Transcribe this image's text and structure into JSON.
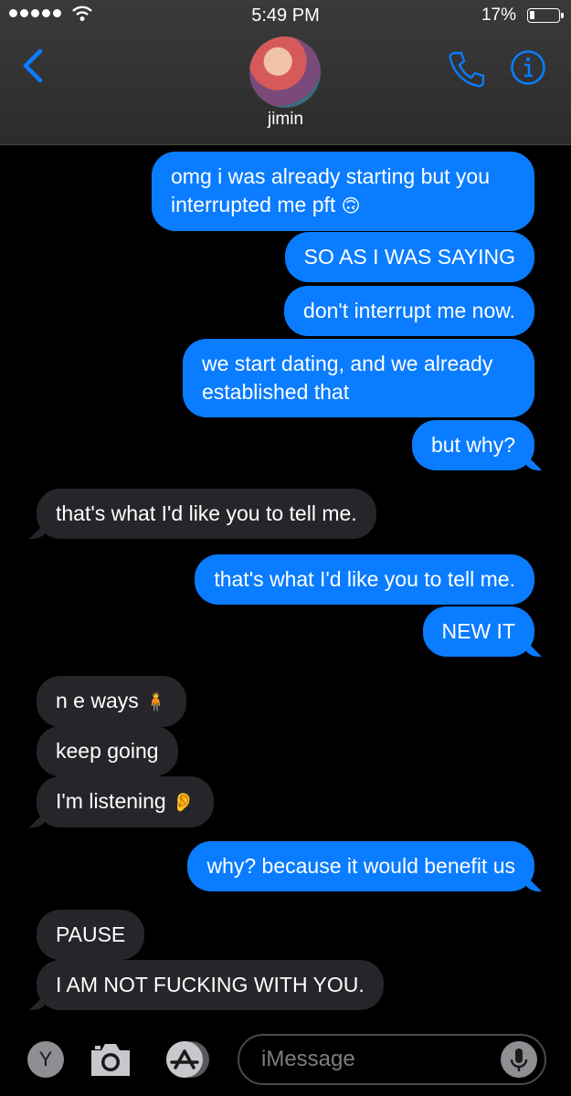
{
  "status": {
    "time": "5:49 PM",
    "battery_pct": "17%",
    "battery_level": 0.17
  },
  "header": {
    "contact_name": "jimin"
  },
  "messages": [
    {
      "dir": "sent",
      "text": "omg i was already starting but you\ninterrupted me pft",
      "emoji": "🙃"
    },
    {
      "dir": "sent",
      "text": "SO AS I WAS SAYING"
    },
    {
      "dir": "sent",
      "text": "don't interrupt me now."
    },
    {
      "dir": "sent",
      "text": "we start dating, and we already\nestablished that"
    },
    {
      "dir": "sent",
      "text": "but why?"
    },
    {
      "dir": "recv",
      "text": "that's what I'd like you to tell me."
    },
    {
      "dir": "sent",
      "text": "that's what I'd like you to tell me."
    },
    {
      "dir": "sent",
      "text": "NEW IT"
    },
    {
      "dir": "recv",
      "text": "n e ways",
      "emoji": "🧍"
    },
    {
      "dir": "recv",
      "text": "keep going"
    },
    {
      "dir": "recv",
      "text": "I'm listening",
      "emoji": "👂"
    },
    {
      "dir": "sent",
      "text": "why? because it would benefit us"
    },
    {
      "dir": "recv",
      "text": "PAUSE"
    },
    {
      "dir": "recv",
      "text": "I AM NOT FUCKING WITH YOU."
    }
  ],
  "composer": {
    "y_label": "Y",
    "placeholder": "iMessage"
  },
  "colors": {
    "sent": "#0a7cff",
    "received": "#262529",
    "accent": "#0a7cff"
  },
  "icons": [
    "back-chevron-icon",
    "phone-icon",
    "info-icon",
    "camera-icon",
    "app-store-icon",
    "mic-icon"
  ]
}
